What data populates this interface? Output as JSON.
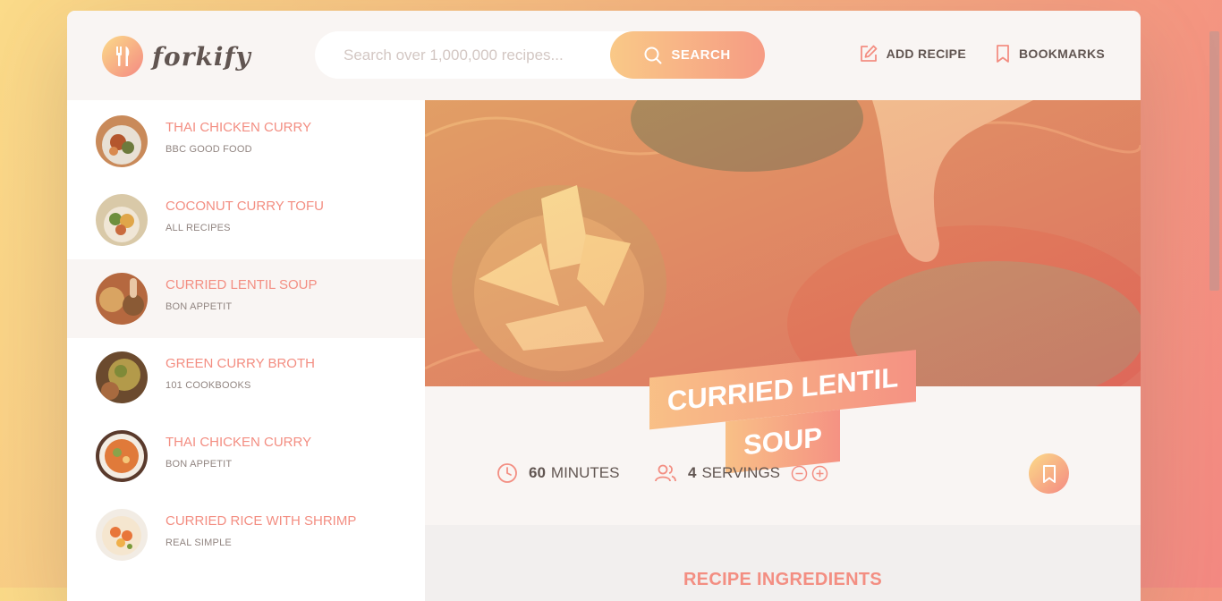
{
  "header": {
    "logo_text": "forkify",
    "search_placeholder": "Search over 1,000,000 recipes...",
    "search_button": "SEARCH",
    "nav": {
      "add_recipe": "ADD RECIPE",
      "bookmarks": "BOOKMARKS"
    }
  },
  "results": [
    {
      "title": "THAI CHICKEN CURRY",
      "publisher": "BBC GOOD FOOD",
      "active": false
    },
    {
      "title": "COCONUT CURRY TOFU",
      "publisher": "ALL RECIPES",
      "active": false
    },
    {
      "title": "CURRIED LENTIL SOUP",
      "publisher": "BON APPETIT",
      "active": true
    },
    {
      "title": "GREEN CURRY BROTH",
      "publisher": "101 COOKBOOKS",
      "active": false
    },
    {
      "title": "THAI CHICKEN CURRY",
      "publisher": "BON APPETIT",
      "active": false
    },
    {
      "title": "CURRIED RICE WITH SHRIMP",
      "publisher": "REAL SIMPLE",
      "active": false
    }
  ],
  "recipe": {
    "title_line1": "CURRIED LENTIL",
    "title_line2": "SOUP",
    "minutes_value": "60",
    "minutes_label": "MINUTES",
    "servings_value": "4",
    "servings_label": "SERVINGS",
    "ingredients_heading": "RECIPE INGREDIENTS"
  },
  "colors": {
    "accent": "#f38e82",
    "gradient_start": "#fbdb89",
    "gradient_end": "#f48982"
  }
}
